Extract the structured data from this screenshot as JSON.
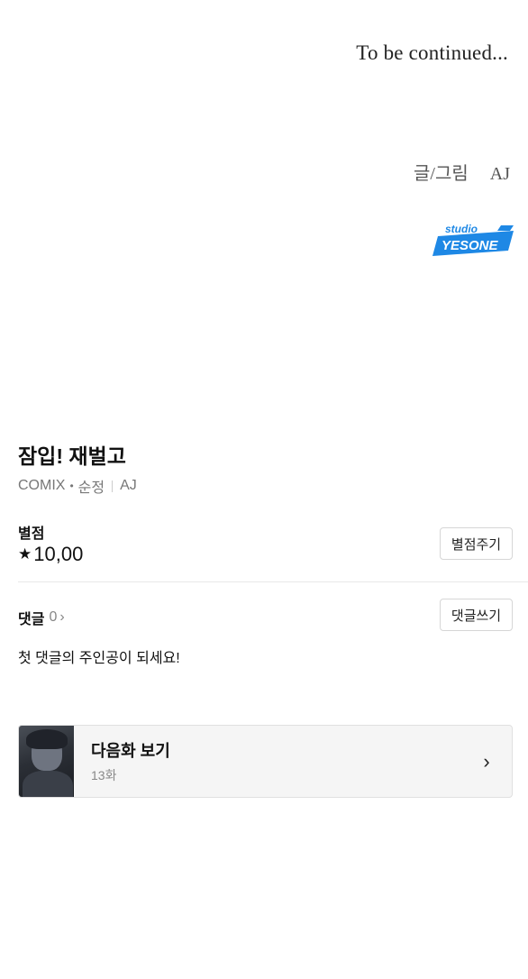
{
  "ending": {
    "to_be_continued": "To be continued...",
    "credit_role": "글/그림",
    "credit_name": "AJ"
  },
  "studio_logo": {
    "line1": "studio",
    "line2": "YESONE",
    "color": "#1e88e5"
  },
  "series": {
    "title": "잠입! 재벌고",
    "label": "COMIX",
    "genre": "순정",
    "author": "AJ"
  },
  "rating": {
    "label": "별점",
    "star_icon": "star-icon",
    "value": "10,00",
    "rate_button": "별점주기"
  },
  "comments": {
    "label": "댓글",
    "count": "0",
    "write_button": "댓글쓰기",
    "empty_message": "첫 댓글의 주인공이 되세요!"
  },
  "next_episode": {
    "title": "다음화 보기",
    "episode": "13화"
  }
}
